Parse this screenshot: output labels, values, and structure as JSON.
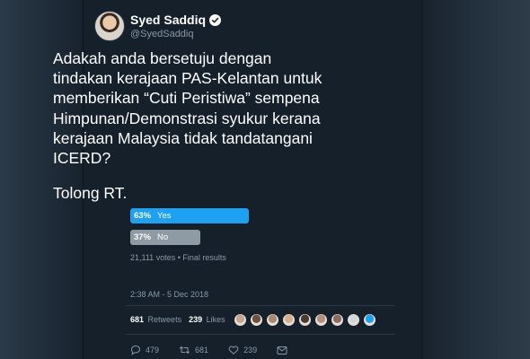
{
  "user": {
    "display_name": "Syed Saddiq",
    "handle": "@SyedSaddiq",
    "verified_icon": "verified-badge-icon"
  },
  "tweet": {
    "text": "Adakah anda bersetuju dengan tindakan kerajaan PAS-Kelantan untuk memberikan “Cuti Peristiwa” sempena Himpunan/Demonstrasi syukur kerana kerajaan Malaysia tidak tandatangani ICERD?",
    "text2": "Tolong RT."
  },
  "poll": {
    "options": [
      {
        "percent_label": "63%",
        "label": "Yes",
        "percent": 63,
        "color": "#1da1f2"
      },
      {
        "percent_label": "37%",
        "label": "No",
        "percent": 37,
        "color": "#8e9aa4"
      }
    ],
    "meta": "21,111 votes • Final results"
  },
  "timestamp": "2:38 AM - 5 Dec 2018",
  "stats": {
    "retweets_count": "681",
    "retweets_label": "Retweets",
    "likes_count": "239",
    "likes_label": "Likes"
  },
  "liker_avatars_count": 9,
  "actions": {
    "reply_count": "479",
    "retweet_count": "681",
    "like_count": "239"
  },
  "colors": {
    "background": "#15202b",
    "accent": "#1da1f2",
    "secondary_text": "#8899a6"
  }
}
